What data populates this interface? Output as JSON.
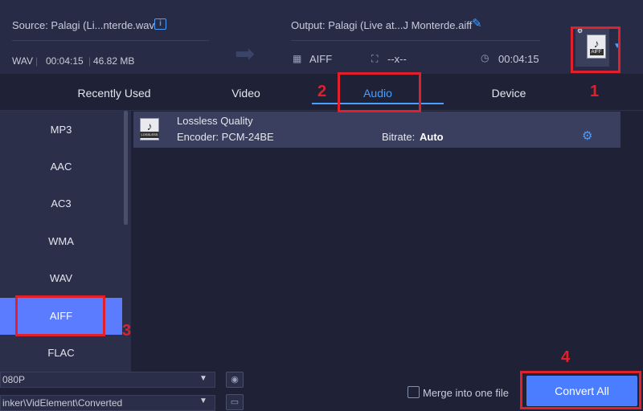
{
  "source": {
    "label": "Source: Palagi (Li...nterde.wav",
    "format": "WAV",
    "duration": "00:04:15",
    "size": "46.82 MB"
  },
  "output": {
    "label": "Output: Palagi (Live at...J Monterde.aiff",
    "format": "AIFF",
    "resolution": "--x--",
    "duration": "00:04:15"
  },
  "format_thumb": {
    "ext": "AIFF"
  },
  "tabs": [
    "Recently Used",
    "Video",
    "Audio",
    "Device"
  ],
  "active_tab": "Audio",
  "sidebar": {
    "items": [
      "MP3",
      "AAC",
      "AC3",
      "WMA",
      "WAV",
      "AIFF",
      "FLAC"
    ],
    "selected": "AIFF"
  },
  "preset": {
    "title": "Lossless Quality",
    "encoder": "Encoder: PCM-24BE",
    "bitrate_label": "Bitrate:",
    "bitrate_value": "Auto",
    "icon_label": "LOSSLESS"
  },
  "bottom": {
    "resolution_field": "080P",
    "path_field": "inker\\VidElement\\Converted",
    "merge_label": "Merge into one file",
    "convert_label": "Convert All"
  },
  "annotations": [
    "1",
    "2",
    "3",
    "4"
  ],
  "colors": {
    "accent": "#4a9eff",
    "selected": "#5b7cff",
    "convert": "#4a7dff",
    "annotation": "#e0202a"
  }
}
